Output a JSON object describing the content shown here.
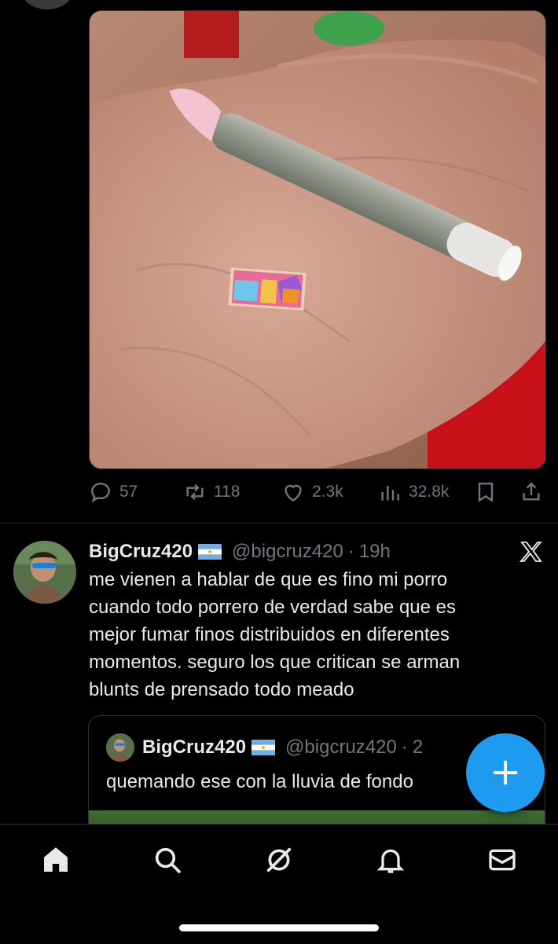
{
  "tweet1": {
    "stats": {
      "replies": "57",
      "reposts": "118",
      "likes": "2.3k",
      "views": "32.8k"
    }
  },
  "tweet2": {
    "name": "BigCruz420",
    "handle": "@bigcruz420",
    "dot": "·",
    "time": "19h",
    "text_lines": [
      "me vienen a hablar de que es fino mi porro",
      "cuando todo porrero de verdad sabe que es",
      "mejor fumar finos distribuidos en diferentes",
      "momentos. seguro los que critican se arman",
      "blunts de prensado todo meado"
    ],
    "quote": {
      "name": "BigCruz420",
      "handle": "@bigcruz420",
      "dot": "·",
      "time_partial": "2",
      "text": "quemando ese con la lluvia de fondo"
    }
  },
  "icons": {
    "reply": "reply-icon",
    "repost": "repost-icon",
    "like": "heart-icon",
    "views": "views-icon",
    "bookmark": "bookmark-icon",
    "share": "share-icon",
    "x": "x-logo-icon",
    "compose": "plus-icon",
    "nav": [
      "home-icon",
      "search-icon",
      "grok-icon",
      "bell-icon",
      "mail-icon"
    ]
  },
  "colors": {
    "accent": "#1d9bf0",
    "background": "#000000",
    "muted": "#71767b",
    "text": "#e7e9ea"
  }
}
